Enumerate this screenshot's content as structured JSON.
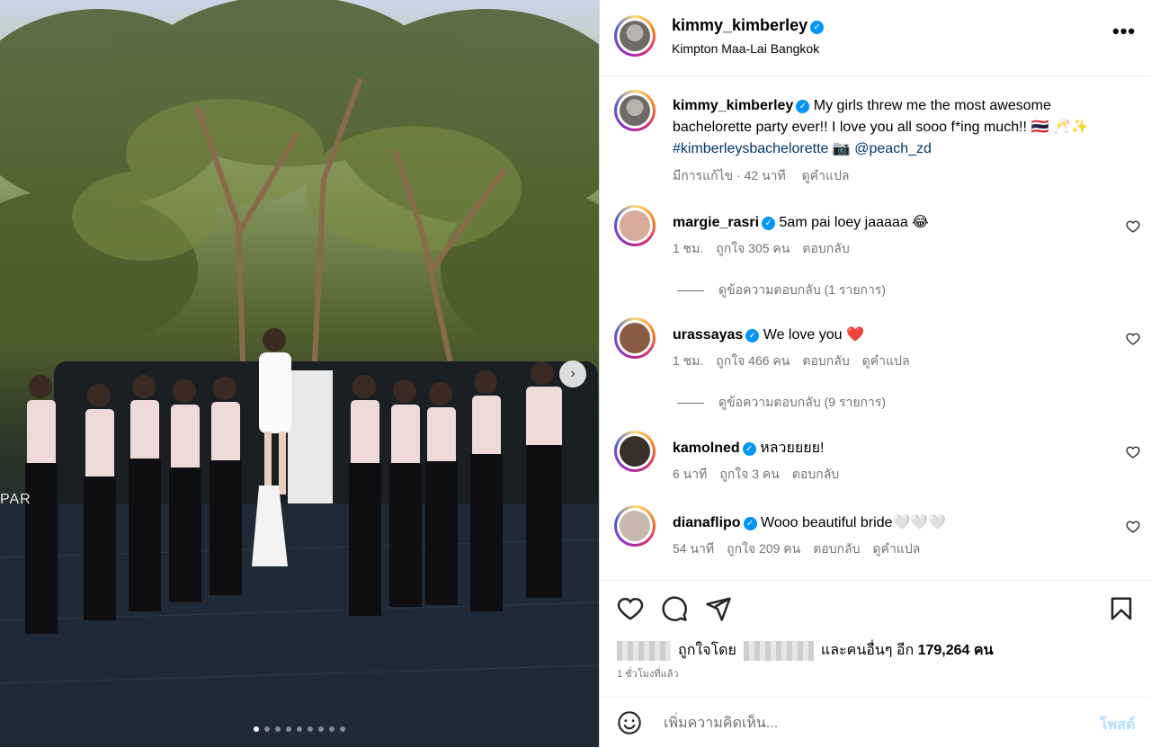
{
  "post": {
    "username": "kimmy_kimberley",
    "location": "Kimpton Maa-Lai Bangkok",
    "more_label": "•••",
    "photo_dots_total": 9,
    "photo_dots_active": 0,
    "photo_sign_text": "PAR"
  },
  "caption": {
    "username": "kimmy_kimberley",
    "text_1": "My girls threw me the most awesome bachelorette party ever!! I love you all sooo f*ing much!! 🇹🇭",
    "emojis": "🥂✨",
    "hashtag": "#kimberleysbachelorette",
    "camera": "📷",
    "mention": "@peach_zd",
    "meta_edited": "มีการแก้ไข · 42 นาที",
    "meta_translate": "ดูคำแปล"
  },
  "comments": [
    {
      "username": "margie_rasri",
      "text": "5am pai loey jaaaaa 😂",
      "time": "1 ชม.",
      "likes": "ถูกใจ 305 คน",
      "reply": "ตอบกลับ",
      "translate": "",
      "replies": "ดูข้อความตอบกลับ (1 รายการ)",
      "avatar_color": "#d9a99a"
    },
    {
      "username": "urassayas",
      "text": "We love you ❤️",
      "time": "1 ชม.",
      "likes": "ถูกใจ 466 คน",
      "reply": "ตอบกลับ",
      "translate": "ดูคำแปล",
      "replies": "ดูข้อความตอบกลับ (9 รายการ)",
      "avatar_color": "#8a5a44"
    },
    {
      "username": "kamolned",
      "text": "หลวยยยย!",
      "time": "6 นาที",
      "likes": "ถูกใจ 3 คน",
      "reply": "ตอบกลับ",
      "translate": "",
      "replies": "",
      "avatar_color": "#3a2f2a"
    },
    {
      "username": "dianaflipo",
      "text": "Wooo beautiful bride🤍🤍🤍",
      "time": "54 นาที",
      "likes": "ถูกใจ 209 คน",
      "reply": "ตอบกลับ",
      "translate": "ดูคำแปล",
      "replies": "",
      "avatar_color": "#c9b8ad"
    }
  ],
  "likes": {
    "liked_by_prefix": "ถูกใจโดย",
    "and_others": "และคนอื่นๆ อีก",
    "count": "179,264",
    "suffix": "คน",
    "time_ago": "1 ชั่วโมงที่แล้ว"
  },
  "comment_box": {
    "placeholder": "เพิ่มความคิดเห็น...",
    "post_label": "โพสต์"
  },
  "icons": [
    "heart-icon",
    "comment-icon",
    "share-icon",
    "bookmark-icon",
    "emoji-icon",
    "verified-icon",
    "chevron-right-icon",
    "more-icon"
  ],
  "colors": {
    "accent": "#0095f6",
    "link": "#00376b",
    "muted": "#737373",
    "post_disabled": "#b3dbff"
  }
}
